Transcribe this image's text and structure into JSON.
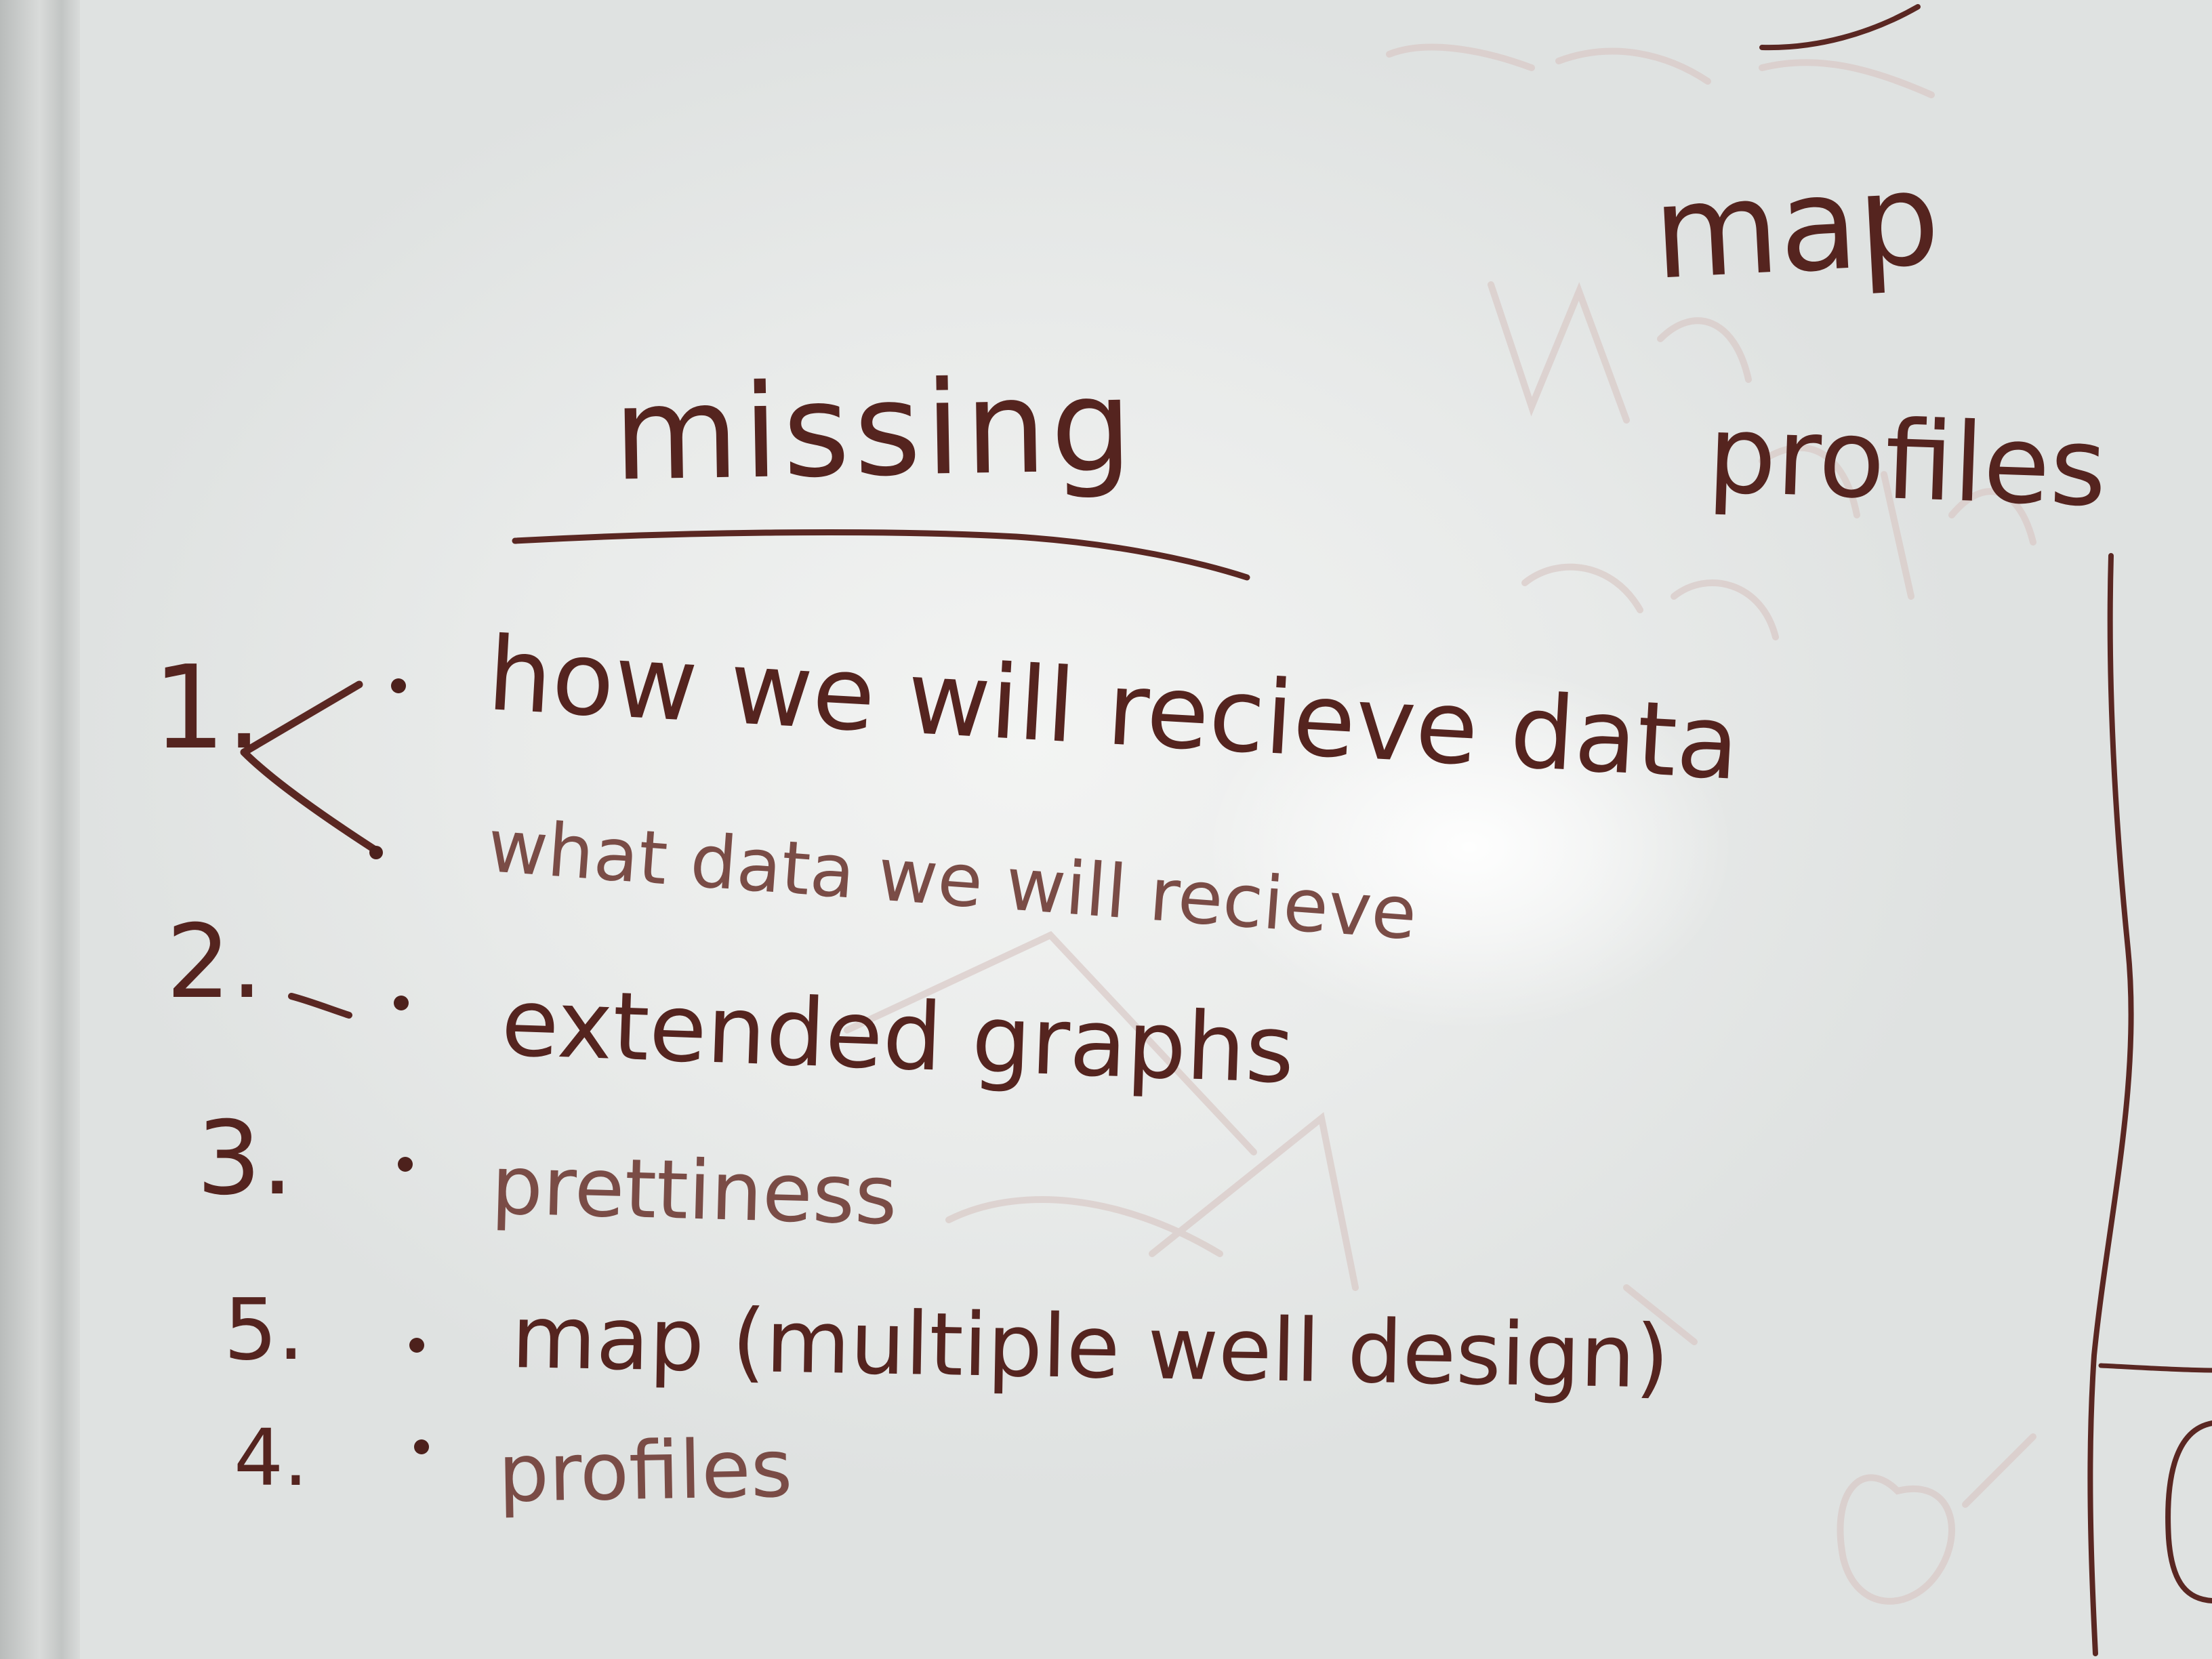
{
  "whiteboard": {
    "heading": "missing",
    "items": [
      {
        "number": "1.",
        "text": "how we will recieve data"
      },
      {
        "number": "",
        "text": "what data we will recieve"
      },
      {
        "number": "2.",
        "text": "extended graphs"
      },
      {
        "number": "3.",
        "text": "prettiness"
      },
      {
        "number": "5.",
        "text": "map (multiple well design)"
      },
      {
        "number": "4.",
        "text": "profiles"
      }
    ],
    "side_notes": [
      "map",
      "profiles"
    ],
    "ink_color": "#5a2722",
    "board_color": "#eceeed"
  }
}
